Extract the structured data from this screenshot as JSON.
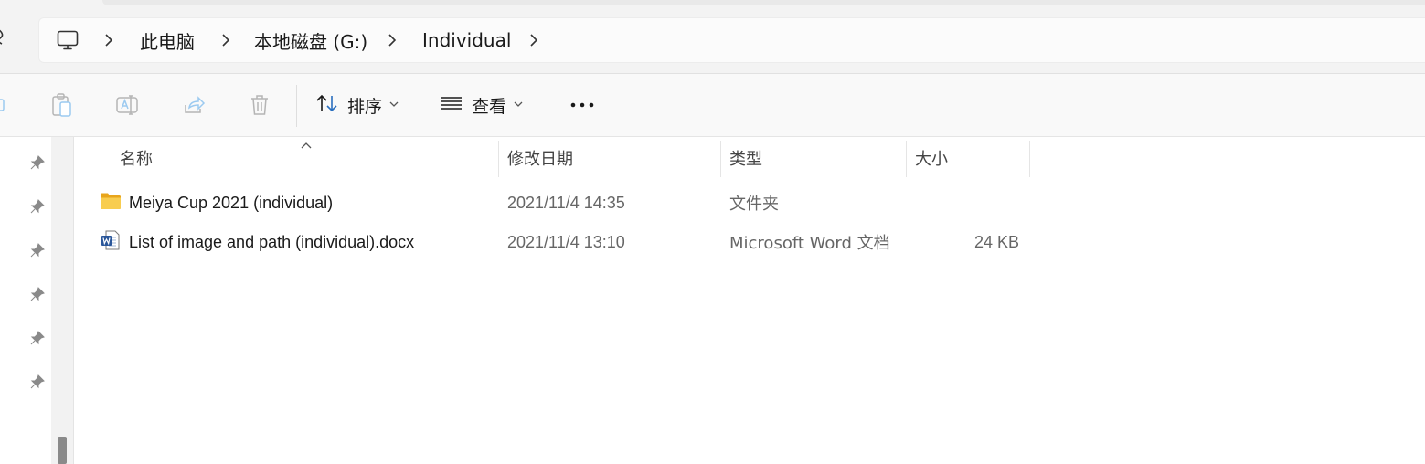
{
  "address_bar": {
    "breadcrumbs": [
      "此电脑",
      "本地磁盘 (G:)",
      "Individual"
    ]
  },
  "toolbar": {
    "sort_label": "排序",
    "view_label": "查看"
  },
  "file_list": {
    "columns": {
      "name": "名称",
      "modified": "修改日期",
      "type": "类型",
      "size": "大小"
    },
    "rows": [
      {
        "icon": "folder-icon",
        "name": "Meiya Cup 2021 (individual)",
        "modified": "2021/11/4 14:35",
        "type": "文件夹",
        "size": ""
      },
      {
        "icon": "word-document-icon",
        "name": "List of image and path (individual).docx",
        "modified": "2021/11/4 13:10",
        "type": "Microsoft Word 文档",
        "size": "24 KB"
      }
    ]
  },
  "colors": {
    "folder": "#f5c342",
    "word_blue": "#2b579a",
    "pin": "#8a8a8a"
  }
}
